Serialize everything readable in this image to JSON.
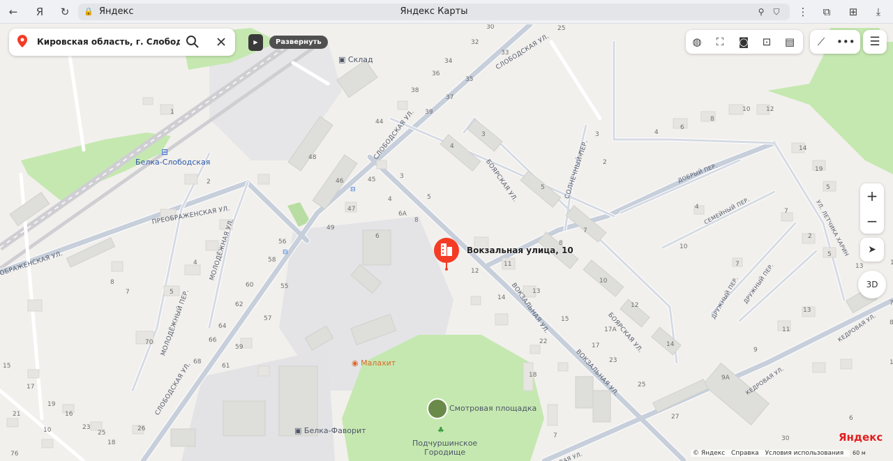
{
  "browser": {
    "site": "Яндекс",
    "title": "Яндекс Карты",
    "icons": [
      "back-icon",
      "yandex-icon",
      "reload-icon",
      "location-icon",
      "bookmark-icon",
      "more-icon",
      "extensions-icon",
      "collections-icon",
      "download-icon"
    ]
  },
  "search": {
    "value": "Кировская область, г. Слободской, ул",
    "pin_color": "#f43b25"
  },
  "panel": {
    "expand_label": "Развернуть"
  },
  "toolbar": {
    "icons": [
      "layers-icon",
      "panorama-icon",
      "camera-icon",
      "transport-icon",
      "traffic-icon",
      "ruler-icon",
      "more-icon"
    ]
  },
  "controls": {
    "zoom_in": "+",
    "zoom_out": "−",
    "btn_3d": "3D"
  },
  "marker": {
    "label": "Вокзальная улица, 10",
    "color": "#f43b25"
  },
  "poi": {
    "station": "Белка-Слободская",
    "warehouse": "Склад",
    "malakhit": "Малахит",
    "viewpoint": "Смотровая площадка",
    "settlement_1": "Подчуршинское",
    "settlement_2": "Городище",
    "belka_favorit": "Белка-Фаворит"
  },
  "streets": {
    "slobodskaya_top": "СЛОБОДСКАЯ УЛ.",
    "slobodskaya_mid": "СЛОБОДСКАЯ УЛ.",
    "slobodskaya_bottom": "СЛОБОДСКАЯ УЛ.",
    "preobrazhenskaya": "ПРЕОБРАЖЕНСКАЯ УЛ.",
    "preobrazhenskaya_left": "ОБРАЖЕНСКАЯ УЛ.",
    "molodezhnaya": "МОЛОДЁЖНАЯ УЛ.",
    "molodezhny_per": "МОЛОДЁЖНЫЙ ПЕР.",
    "boyarskaya_top": "БОЯРСКАЯ УЛ.",
    "boyarskaya_bottom": "БОЯРСКАЯ УЛ.",
    "vokzalnaya_mid": "ВОКЗАЛЬНАЯ УЛ.",
    "vokzalnaya_bottom": "ВОКЗАЛЬНАЯ УЛ.",
    "solnechny": "СОЛНЕЧНЫЙ ПЕР.",
    "dobry": "ДОБРЫЙ ПЕР.",
    "semeyny": "СЕМЕЙНЫЙ ПЕР.",
    "druzhny_1": "ДРУЖНЫЙ ПЕР.",
    "druzhny_2": "ДРУЖНЫЙ ПЕР.",
    "letchika": "УЛ. ЛЕТЧИКА ХАРИН",
    "kedrovaya_top": "КЕДРОВАЯ УЛ.",
    "kedrovaya_mid": "КЕДРОВАЯ УЛ.",
    "kedrovaya_bottom": "КЕДРОВАЯ УЛ."
  },
  "house_numbers": [
    {
      "n": "30"
    },
    {
      "n": "25"
    },
    {
      "n": "32"
    },
    {
      "n": "33"
    },
    {
      "n": "34"
    },
    {
      "n": "36"
    },
    {
      "n": "35"
    },
    {
      "n": "38"
    },
    {
      "n": "37"
    },
    {
      "n": "39"
    },
    {
      "n": "44"
    },
    {
      "n": "3"
    },
    {
      "n": "4"
    },
    {
      "n": "48"
    },
    {
      "n": "46"
    },
    {
      "n": "45"
    },
    {
      "n": "3"
    },
    {
      "n": "47"
    },
    {
      "n": "4"
    },
    {
      "n": "5"
    },
    {
      "n": "6А"
    },
    {
      "n": "8"
    },
    {
      "n": "49"
    },
    {
      "n": "6"
    },
    {
      "n": "56"
    },
    {
      "n": "58"
    },
    {
      "n": "55"
    },
    {
      "n": "60"
    },
    {
      "n": "62"
    },
    {
      "n": "57"
    },
    {
      "n": "64"
    },
    {
      "n": "66"
    },
    {
      "n": "59"
    },
    {
      "n": "68"
    },
    {
      "n": "61"
    },
    {
      "n": "70"
    },
    {
      "n": "1"
    },
    {
      "n": "2"
    },
    {
      "n": "4"
    },
    {
      "n": "5"
    },
    {
      "n": "7"
    },
    {
      "n": "8"
    },
    {
      "n": "12"
    },
    {
      "n": "14"
    },
    {
      "n": "11"
    },
    {
      "n": "13"
    },
    {
      "n": "15"
    },
    {
      "n": "22"
    },
    {
      "n": "17"
    },
    {
      "n": "17А"
    },
    {
      "n": "23"
    },
    {
      "n": "18"
    },
    {
      "n": "25"
    },
    {
      "n": "7"
    },
    {
      "n": "5"
    },
    {
      "n": "8"
    },
    {
      "n": "7"
    },
    {
      "n": "10"
    },
    {
      "n": "12"
    },
    {
      "n": "14"
    },
    {
      "n": "1"
    },
    {
      "n": "2"
    },
    {
      "n": "3"
    },
    {
      "n": "4"
    },
    {
      "n": "6"
    },
    {
      "n": "8"
    },
    {
      "n": "10"
    },
    {
      "n": "12"
    },
    {
      "n": "14"
    },
    {
      "n": "19"
    },
    {
      "n": "5"
    },
    {
      "n": "2"
    },
    {
      "n": "7"
    },
    {
      "n": "4"
    },
    {
      "n": "10"
    },
    {
      "n": "7"
    },
    {
      "n": "5"
    },
    {
      "n": "13"
    },
    {
      "n": "11"
    },
    {
      "n": "9"
    },
    {
      "n": "9А"
    },
    {
      "n": "27"
    },
    {
      "n": "30"
    },
    {
      "n": "1"
    },
    {
      "n": "13"
    },
    {
      "n": "15"
    },
    {
      "n": "17"
    },
    {
      "n": "19"
    },
    {
      "n": "16"
    },
    {
      "n": "21"
    },
    {
      "n": "23"
    },
    {
      "n": "25"
    },
    {
      "n": "18"
    },
    {
      "n": "10"
    },
    {
      "n": "76"
    },
    {
      "n": "26"
    },
    {
      "n": "6"
    },
    {
      "n": "7"
    },
    {
      "n": "8"
    },
    {
      "n": "1"
    }
  ],
  "footer": {
    "copyright": "© Яндекс",
    "help": "Справка",
    "terms": "Условия использования",
    "brand": "Яндекс",
    "scale": "60 м"
  }
}
